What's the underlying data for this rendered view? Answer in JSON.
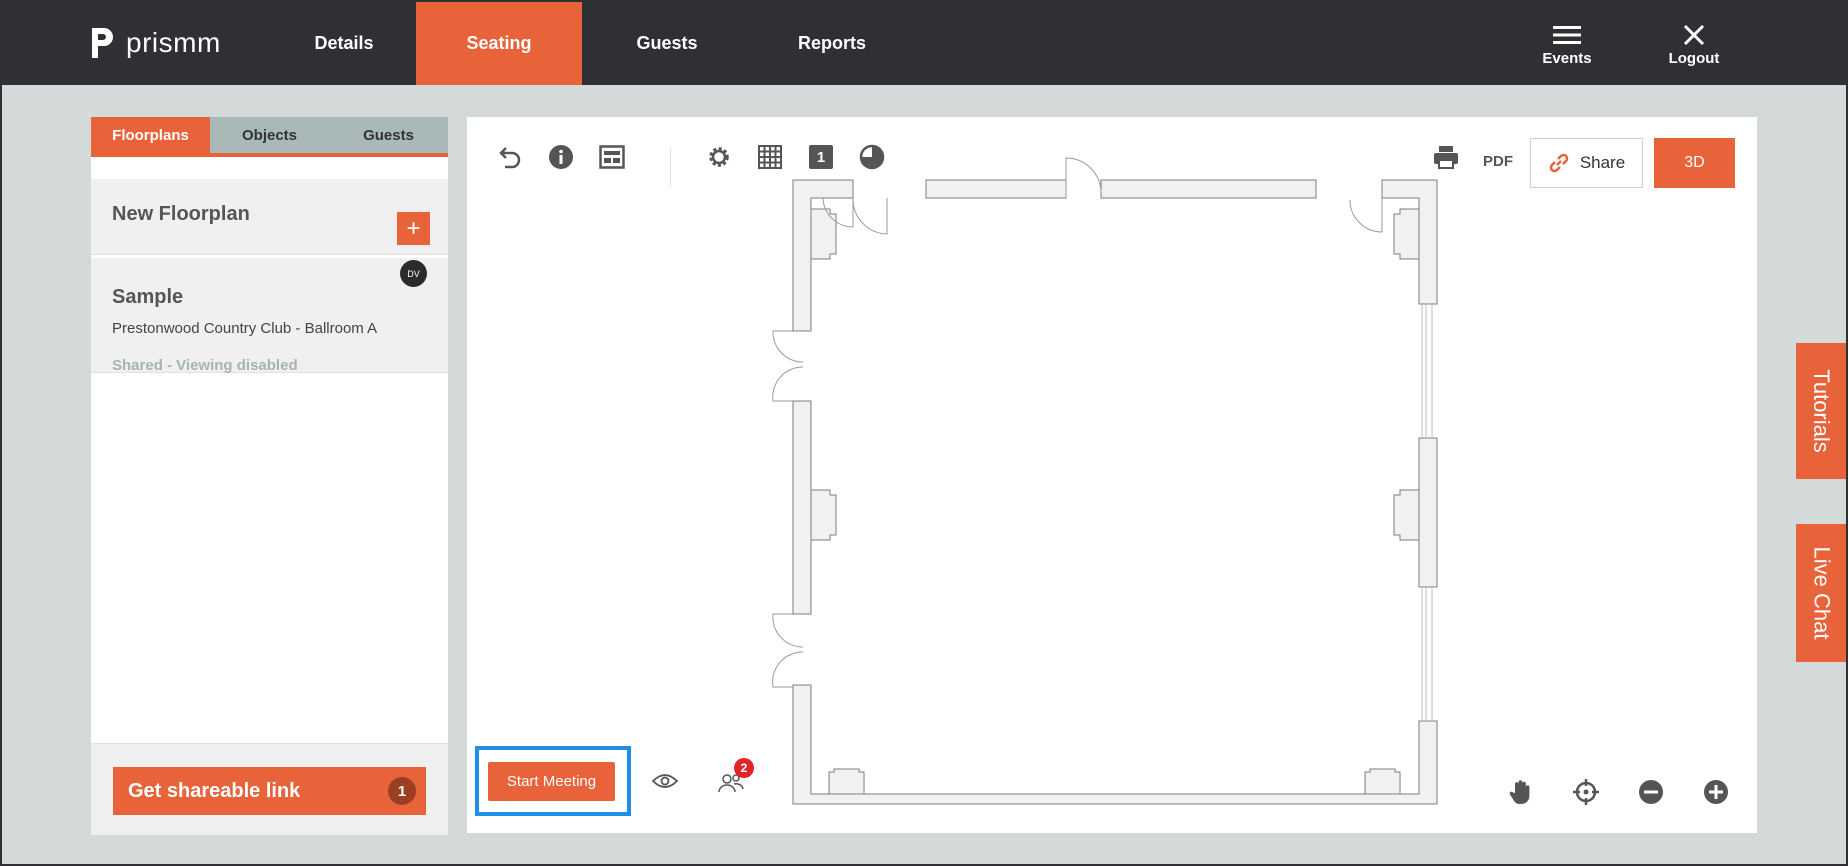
{
  "app": {
    "logo_text": "prismm"
  },
  "nav": {
    "tabs": [
      {
        "label": "Details",
        "active": false
      },
      {
        "label": "Seating",
        "active": true
      },
      {
        "label": "Guests",
        "active": false
      },
      {
        "label": "Reports",
        "active": false
      }
    ],
    "events_label": "Events",
    "logout_label": "Logout"
  },
  "left_panel": {
    "tabs": [
      {
        "label": "Floorplans",
        "active": true
      },
      {
        "label": "Objects",
        "active": false
      },
      {
        "label": "Guests",
        "active": false
      }
    ],
    "new_floorplan_label": "New Floorplan",
    "add_button": "+",
    "floorplans": [
      {
        "title": "Sample",
        "venue": "Prestonwood Country Club - Ballroom A",
        "status": "Shared - Viewing disabled",
        "avatar_initials": "DV"
      }
    ],
    "shareable_link_label": "Get shareable link",
    "shareable_link_count": "1"
  },
  "toolbar": {
    "left_icons": [
      "undo-icon",
      "info-icon",
      "layout-icon"
    ],
    "center_icons": [
      "settings-gear-icon",
      "grid-icon",
      "layer-number-icon",
      "pie-chart-icon"
    ],
    "layer_number": "1",
    "pdf_label": "PDF",
    "share_label": "Share",
    "three_d_label": "3D"
  },
  "canvas_bottom": {
    "start_meeting_label": "Start Meeting",
    "participants_badge": "2"
  },
  "side_tabs": {
    "tutorials": "Tutorials",
    "live_chat": "Live Chat"
  },
  "colors": {
    "accent": "#e8623a",
    "topbar": "#2f3034",
    "backdrop": "#d3dad9",
    "tab_inactive": "#a9b9b7",
    "highlight_frame": "#1e90e6",
    "badge": "#e0252c"
  }
}
